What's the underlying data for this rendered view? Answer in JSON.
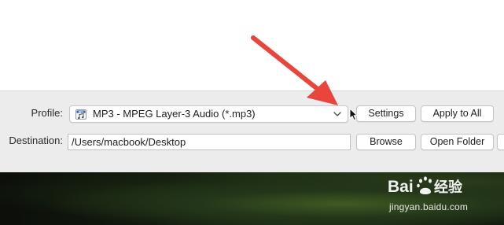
{
  "profile": {
    "label": "Profile:",
    "selected": "MP3 - MPEG Layer-3 Audio (*.mp3)",
    "format_icon": "mp3-file-icon",
    "dropdown_icon": "chevron-down-icon"
  },
  "destination": {
    "label": "Destination:",
    "value": "/Users/macbook/Desktop"
  },
  "buttons": {
    "settings": "Settings",
    "apply_to_all": "Apply to All",
    "browse": "Browse",
    "open_folder": "Open Folder"
  },
  "watermark": {
    "logo": "Baidu 经验",
    "url": "jingyan.baidu.com"
  },
  "colors": {
    "annotation_arrow": "#e8463c",
    "panel_bg": "#ececec"
  }
}
